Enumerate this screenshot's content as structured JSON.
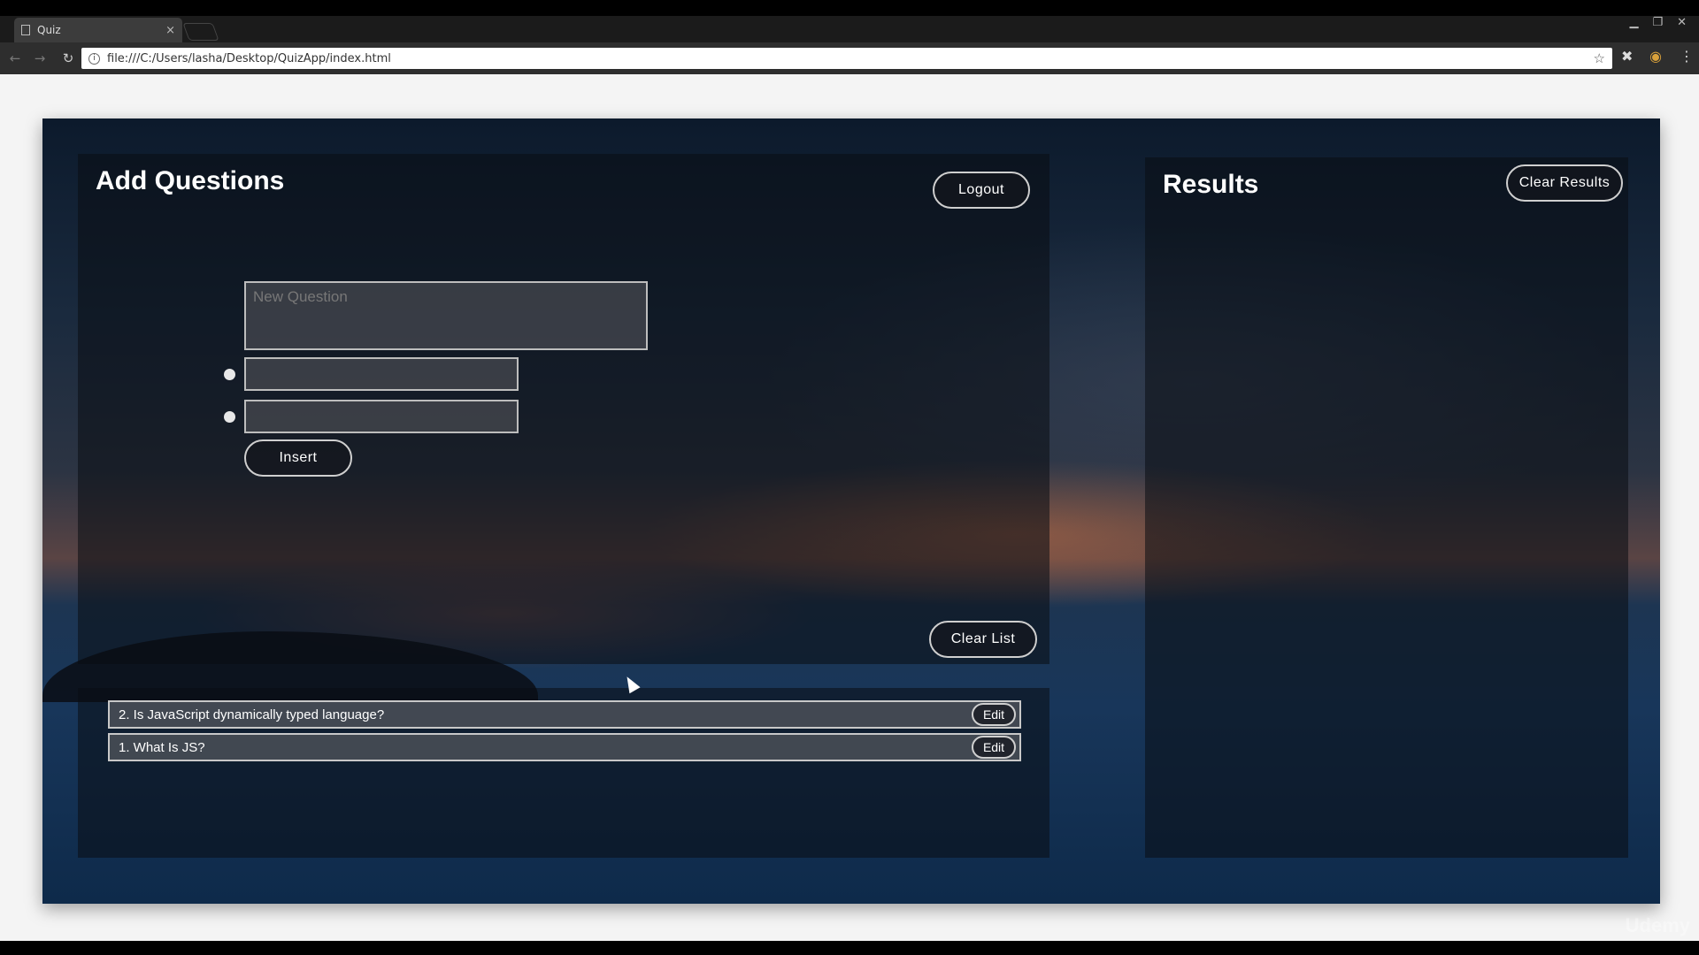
{
  "browser": {
    "tab_title": "Quiz",
    "tab_close": "×",
    "url": "file:///C:/Users/lasha/Desktop/QuizApp/index.html",
    "back": "←",
    "forward": "→",
    "reload": "↻",
    "star": "☆",
    "window_controls": [
      "▁",
      "❐",
      "✕"
    ],
    "extensions": [
      "✖",
      "◉",
      "⋮"
    ]
  },
  "add_panel": {
    "title": "Add Questions",
    "logout_label": "Logout",
    "question_placeholder": "New Question",
    "insert_label": "Insert",
    "clear_list_label": "Clear List"
  },
  "question_list": [
    {
      "text": "2. Is JavaScript dynamically typed language?",
      "edit_label": "Edit"
    },
    {
      "text": "1. What Is JS?",
      "edit_label": "Edit"
    }
  ],
  "results_panel": {
    "title": "Results",
    "clear_results_label": "Clear Results"
  },
  "watermark": "Udemy"
}
